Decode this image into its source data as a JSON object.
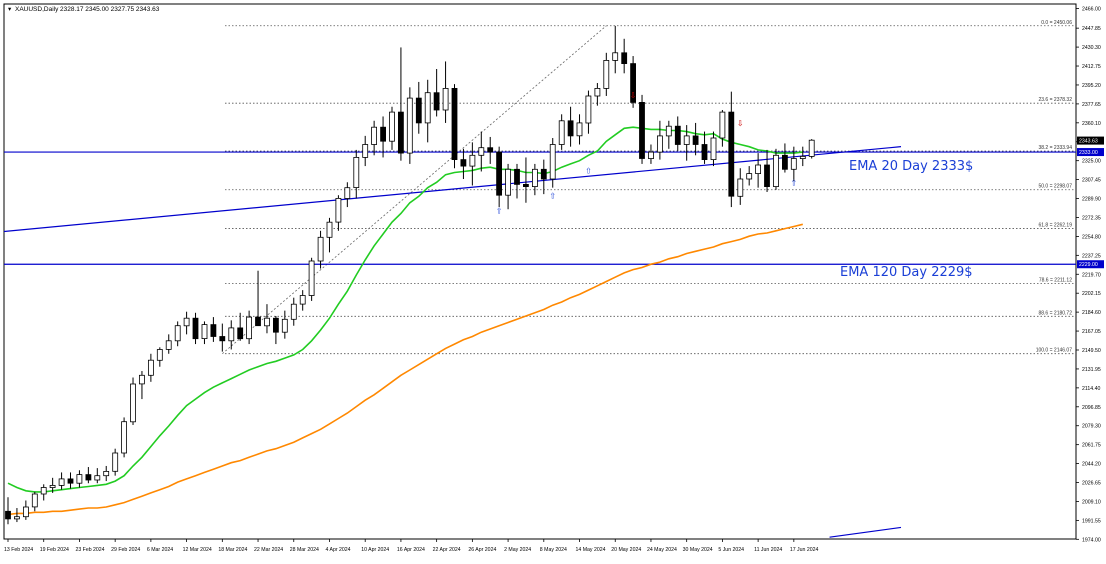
{
  "header": {
    "symbol_label": "XAUUSD,Daily",
    "ohlc_label": "2328.17 2345.00 2327.75 2343.63"
  },
  "chart_data": {
    "type": "candlestick",
    "symbol": "XAUUSD",
    "timeframe": "Daily",
    "ylim": [
      1974.0,
      2466.0
    ],
    "y_ticks": [
      1974.0,
      1991.55,
      2009.1,
      2026.65,
      2044.2,
      2061.75,
      2079.3,
      2096.85,
      2114.4,
      2131.95,
      2149.5,
      2167.05,
      2184.6,
      2202.15,
      2219.7,
      2237.25,
      2254.8,
      2272.35,
      2289.9,
      2307.45,
      2325.0,
      2342.55,
      2360.1,
      2377.65,
      2395.2,
      2412.75,
      2430.3,
      2447.85,
      2466.0
    ],
    "y_tick_labels": [
      "1974.00",
      "1991.55",
      "2009.10",
      "2026.65",
      "2044.20",
      "2061.75",
      "2079.30",
      "2096.85",
      "2114.40",
      "2131.95",
      "2149.50",
      "2167.05",
      "2184.60",
      "2202.15",
      "2219.70",
      "2237.25",
      "2254.80",
      "2272.35",
      "2289.90",
      "2307.45",
      "2325.00",
      "2342.55",
      "2360.10",
      "2377.65",
      "2395.20",
      "2412.75",
      "2430.30",
      "2447.85",
      "2466.00"
    ],
    "x_tick_labels": [
      {
        "i": 0,
        "label": "13 Feb 2024"
      },
      {
        "i": 4,
        "label": "19 Feb 2024"
      },
      {
        "i": 8,
        "label": "23 Feb 2024"
      },
      {
        "i": 12,
        "label": "29 Feb 2024"
      },
      {
        "i": 16,
        "label": "6 Mar 2024"
      },
      {
        "i": 20,
        "label": "12 Mar 2024"
      },
      {
        "i": 24,
        "label": "18 Mar 2024"
      },
      {
        "i": 28,
        "label": "22 Mar 2024"
      },
      {
        "i": 32,
        "label": "28 Mar 2024"
      },
      {
        "i": 36,
        "label": "4 Apr 2024"
      },
      {
        "i": 40,
        "label": "10 Apr 2024"
      },
      {
        "i": 44,
        "label": "16 Apr 2024"
      },
      {
        "i": 48,
        "label": "22 Apr 2024"
      },
      {
        "i": 52,
        "label": "26 Apr 2024"
      },
      {
        "i": 56,
        "label": "2 May 2024"
      },
      {
        "i": 60,
        "label": "8 May 2024"
      },
      {
        "i": 64,
        "label": "14 May 2024"
      },
      {
        "i": 68,
        "label": "20 May 2024"
      },
      {
        "i": 72,
        "label": "24 May 2024"
      },
      {
        "i": 76,
        "label": "30 May 2024"
      },
      {
        "i": 80,
        "label": "5 Jun 2024"
      },
      {
        "i": 84,
        "label": "11 Jun 2024"
      },
      {
        "i": 88,
        "label": "17 Jun 2024"
      }
    ],
    "candles": [
      {
        "o": 2000,
        "h": 2013,
        "l": 1988,
        "c": 1993
      },
      {
        "o": 1993,
        "h": 2003,
        "l": 1990,
        "c": 1995
      },
      {
        "o": 1995,
        "h": 2010,
        "l": 1992,
        "c": 2004
      },
      {
        "o": 2004,
        "h": 2018,
        "l": 2000,
        "c": 2016
      },
      {
        "o": 2016,
        "h": 2025,
        "l": 2010,
        "c": 2022
      },
      {
        "o": 2022,
        "h": 2031,
        "l": 2017,
        "c": 2024
      },
      {
        "o": 2024,
        "h": 2036,
        "l": 2020,
        "c": 2030
      },
      {
        "o": 2030,
        "h": 2036,
        "l": 2021,
        "c": 2026
      },
      {
        "o": 2026,
        "h": 2038,
        "l": 2022,
        "c": 2034
      },
      {
        "o": 2034,
        "h": 2041,
        "l": 2026,
        "c": 2029
      },
      {
        "o": 2029,
        "h": 2040,
        "l": 2026,
        "c": 2033
      },
      {
        "o": 2033,
        "h": 2042,
        "l": 2028,
        "c": 2037
      },
      {
        "o": 2037,
        "h": 2058,
        "l": 2033,
        "c": 2054
      },
      {
        "o": 2054,
        "h": 2087,
        "l": 2050,
        "c": 2083
      },
      {
        "o": 2083,
        "h": 2124,
        "l": 2080,
        "c": 2118
      },
      {
        "o": 2118,
        "h": 2130,
        "l": 2104,
        "c": 2126
      },
      {
        "o": 2126,
        "h": 2146,
        "l": 2120,
        "c": 2140
      },
      {
        "o": 2140,
        "h": 2152,
        "l": 2134,
        "c": 2150
      },
      {
        "o": 2150,
        "h": 2164,
        "l": 2146,
        "c": 2158
      },
      {
        "o": 2158,
        "h": 2176,
        "l": 2153,
        "c": 2172
      },
      {
        "o": 2172,
        "h": 2185,
        "l": 2164,
        "c": 2179
      },
      {
        "o": 2179,
        "h": 2184,
        "l": 2155,
        "c": 2160
      },
      {
        "o": 2160,
        "h": 2176,
        "l": 2155,
        "c": 2173
      },
      {
        "o": 2173,
        "h": 2180,
        "l": 2157,
        "c": 2162
      },
      {
        "o": 2162,
        "h": 2174,
        "l": 2148,
        "c": 2158
      },
      {
        "o": 2158,
        "h": 2177,
        "l": 2150,
        "c": 2170
      },
      {
        "o": 2170,
        "h": 2184,
        "l": 2158,
        "c": 2160
      },
      {
        "o": 2160,
        "h": 2186,
        "l": 2155,
        "c": 2180
      },
      {
        "o": 2180,
        "h": 2223,
        "l": 2173,
        "c": 2172
      },
      {
        "o": 2172,
        "h": 2192,
        "l": 2165,
        "c": 2179
      },
      {
        "o": 2179,
        "h": 2181,
        "l": 2155,
        "c": 2166
      },
      {
        "o": 2166,
        "h": 2186,
        "l": 2160,
        "c": 2178
      },
      {
        "o": 2178,
        "h": 2198,
        "l": 2172,
        "c": 2192
      },
      {
        "o": 2192,
        "h": 2205,
        "l": 2186,
        "c": 2200
      },
      {
        "o": 2200,
        "h": 2235,
        "l": 2195,
        "c": 2232
      },
      {
        "o": 2232,
        "h": 2260,
        "l": 2225,
        "c": 2254
      },
      {
        "o": 2254,
        "h": 2272,
        "l": 2240,
        "c": 2268
      },
      {
        "o": 2268,
        "h": 2293,
        "l": 2260,
        "c": 2290
      },
      {
        "o": 2290,
        "h": 2305,
        "l": 2282,
        "c": 2300
      },
      {
        "o": 2300,
        "h": 2335,
        "l": 2290,
        "c": 2328
      },
      {
        "o": 2328,
        "h": 2348,
        "l": 2320,
        "c": 2340
      },
      {
        "o": 2340,
        "h": 2362,
        "l": 2330,
        "c": 2356
      },
      {
        "o": 2356,
        "h": 2366,
        "l": 2328,
        "c": 2343
      },
      {
        "o": 2343,
        "h": 2375,
        "l": 2335,
        "c": 2370
      },
      {
        "o": 2370,
        "h": 2430,
        "l": 2325,
        "c": 2332
      },
      {
        "o": 2332,
        "h": 2393,
        "l": 2322,
        "c": 2383
      },
      {
        "o": 2383,
        "h": 2398,
        "l": 2350,
        "c": 2360
      },
      {
        "o": 2360,
        "h": 2400,
        "l": 2342,
        "c": 2388
      },
      {
        "o": 2388,
        "h": 2410,
        "l": 2366,
        "c": 2372
      },
      {
        "o": 2372,
        "h": 2417,
        "l": 2360,
        "c": 2392
      },
      {
        "o": 2392,
        "h": 2396,
        "l": 2318,
        "c": 2326
      },
      {
        "o": 2326,
        "h": 2336,
        "l": 2308,
        "c": 2320
      },
      {
        "o": 2320,
        "h": 2342,
        "l": 2302,
        "c": 2330
      },
      {
        "o": 2330,
        "h": 2352,
        "l": 2315,
        "c": 2337
      },
      {
        "o": 2337,
        "h": 2347,
        "l": 2322,
        "c": 2333
      },
      {
        "o": 2333,
        "h": 2338,
        "l": 2282,
        "c": 2293
      },
      {
        "o": 2293,
        "h": 2322,
        "l": 2280,
        "c": 2317
      },
      {
        "o": 2317,
        "h": 2322,
        "l": 2290,
        "c": 2303
      },
      {
        "o": 2303,
        "h": 2328,
        "l": 2286,
        "c": 2301
      },
      {
        "o": 2301,
        "h": 2322,
        "l": 2293,
        "c": 2317
      },
      {
        "o": 2317,
        "h": 2326,
        "l": 2294,
        "c": 2308
      },
      {
        "o": 2308,
        "h": 2346,
        "l": 2300,
        "c": 2340
      },
      {
        "o": 2340,
        "h": 2368,
        "l": 2335,
        "c": 2362
      },
      {
        "o": 2362,
        "h": 2375,
        "l": 2338,
        "c": 2348
      },
      {
        "o": 2348,
        "h": 2368,
        "l": 2340,
        "c": 2360
      },
      {
        "o": 2360,
        "h": 2390,
        "l": 2350,
        "c": 2385
      },
      {
        "o": 2385,
        "h": 2397,
        "l": 2376,
        "c": 2392
      },
      {
        "o": 2392,
        "h": 2425,
        "l": 2385,
        "c": 2418
      },
      {
        "o": 2418,
        "h": 2450,
        "l": 2406,
        "c": 2425
      },
      {
        "o": 2425,
        "h": 2438,
        "l": 2406,
        "c": 2415
      },
      {
        "o": 2415,
        "h": 2422,
        "l": 2374,
        "c": 2379
      },
      {
        "o": 2379,
        "h": 2386,
        "l": 2322,
        "c": 2327
      },
      {
        "o": 2327,
        "h": 2340,
        "l": 2322,
        "c": 2333
      },
      {
        "o": 2333,
        "h": 2362,
        "l": 2326,
        "c": 2348
      },
      {
        "o": 2348,
        "h": 2362,
        "l": 2336,
        "c": 2357
      },
      {
        "o": 2357,
        "h": 2366,
        "l": 2334,
        "c": 2340
      },
      {
        "o": 2340,
        "h": 2358,
        "l": 2325,
        "c": 2348
      },
      {
        "o": 2348,
        "h": 2360,
        "l": 2330,
        "c": 2340
      },
      {
        "o": 2340,
        "h": 2352,
        "l": 2322,
        "c": 2326
      },
      {
        "o": 2326,
        "h": 2352,
        "l": 2320,
        "c": 2346
      },
      {
        "o": 2346,
        "h": 2372,
        "l": 2338,
        "c": 2370
      },
      {
        "o": 2370,
        "h": 2389,
        "l": 2282,
        "c": 2292
      },
      {
        "o": 2292,
        "h": 2318,
        "l": 2284,
        "c": 2308
      },
      {
        "o": 2308,
        "h": 2320,
        "l": 2302,
        "c": 2313
      },
      {
        "o": 2313,
        "h": 2332,
        "l": 2300,
        "c": 2321
      },
      {
        "o": 2321,
        "h": 2335,
        "l": 2296,
        "c": 2301
      },
      {
        "o": 2301,
        "h": 2336,
        "l": 2298,
        "c": 2330
      },
      {
        "o": 2330,
        "h": 2341,
        "l": 2314,
        "c": 2317
      },
      {
        "o": 2317,
        "h": 2338,
        "l": 2306,
        "c": 2327
      },
      {
        "o": 2327,
        "h": 2338,
        "l": 2320,
        "c": 2329
      },
      {
        "o": 2329,
        "h": 2345,
        "l": 2327,
        "c": 2344
      }
    ],
    "series": [
      {
        "name": "EMA 20 Day",
        "color": "#22cc22",
        "values": [
          2026,
          2022,
          2019,
          2018,
          2018,
          2019,
          2020,
          2021,
          2022,
          2023,
          2024,
          2025,
          2028,
          2033,
          2042,
          2050,
          2060,
          2070,
          2079,
          2089,
          2098,
          2104,
          2110,
          2115,
          2119,
          2123,
          2127,
          2131,
          2134,
          2137,
          2139,
          2142,
          2145,
          2150,
          2158,
          2168,
          2179,
          2192,
          2204,
          2219,
          2233,
          2246,
          2257,
          2268,
          2276,
          2286,
          2292,
          2300,
          2305,
          2312,
          2314,
          2315,
          2316,
          2318,
          2319,
          2317,
          2317,
          2316,
          2314,
          2314,
          2313,
          2315,
          2319,
          2322,
          2325,
          2330,
          2334,
          2343,
          2349,
          2355,
          2356,
          2355,
          2354,
          2354,
          2353,
          2353,
          2352,
          2350,
          2349,
          2350,
          2345,
          2342,
          2340,
          2338,
          2335,
          2334,
          2332,
          2332,
          2332,
          2333
        ]
      },
      {
        "name": "EMA 120 Day",
        "color": "#ff8800",
        "values": [
          1997,
          1998,
          1998,
          1999,
          1999,
          2000,
          2000,
          2001,
          2002,
          2003,
          2003,
          2004,
          2006,
          2008,
          2011,
          2014,
          2017,
          2020,
          2023,
          2027,
          2030,
          2033,
          2036,
          2039,
          2042,
          2045,
          2047,
          2050,
          2053,
          2056,
          2058,
          2061,
          2064,
          2068,
          2072,
          2076,
          2081,
          2086,
          2091,
          2097,
          2103,
          2108,
          2114,
          2120,
          2126,
          2131,
          2136,
          2141,
          2146,
          2151,
          2155,
          2159,
          2162,
          2166,
          2169,
          2172,
          2175,
          2178,
          2181,
          2184,
          2187,
          2191,
          2194,
          2198,
          2201,
          2205,
          2209,
          2213,
          2217,
          2221,
          2224,
          2226,
          2229,
          2231,
          2234,
          2236,
          2239,
          2241,
          2243,
          2245,
          2248,
          2250,
          2252,
          2255,
          2257,
          2258,
          2260,
          2262,
          2264,
          2266
        ]
      }
    ],
    "fibonacci": [
      {
        "label": "0.0 = 2450.06",
        "value": 2450.06
      },
      {
        "label": "23.6 = 2378.32",
        "value": 2378.32
      },
      {
        "label": "38.2 = 2333.94",
        "value": 2333.94
      },
      {
        "label": "50.0 = 2298.07",
        "value": 2298.07
      },
      {
        "label": "61.8 = 2262.19",
        "value": 2262.19
      },
      {
        "label": "78.6 = 2211.12",
        "value": 2211.12
      },
      {
        "label": "88.6 = 2180.72",
        "value": 2180.72
      },
      {
        "label": "100.0 = 2146.07",
        "value": 2146.07
      }
    ],
    "horizontal_lines": [
      {
        "value": 2333.0,
        "label": "2333.00",
        "color": "#0000cc"
      },
      {
        "value": 2229.0,
        "label": "2229.00",
        "color": "#0000cc"
      }
    ],
    "current_price": {
      "value": 2343.63,
      "label": "2343.63"
    },
    "trend_lines": [
      {
        "from": {
          "i": -6,
          "v": 2255
        },
        "to": {
          "i": 100,
          "v": 2338
        },
        "color": "#0000cc"
      },
      {
        "from": {
          "i": 92,
          "v": 1976
        },
        "to": {
          "i": 100,
          "v": 1985
        },
        "color": "#0000cc"
      }
    ],
    "fib_anchor_line": {
      "from": {
        "i": 24,
        "v": 2146.07
      },
      "to": {
        "i": 67,
        "v": 2450.06
      }
    },
    "arrows_up": [
      {
        "i": 55,
        "v": 2276
      },
      {
        "i": 61,
        "v": 2290
      },
      {
        "i": 65,
        "v": 2313
      },
      {
        "i": 88,
        "v": 2302
      }
    ],
    "arrows_down": [
      {
        "i": 70,
        "v": 2383
      },
      {
        "i": 82,
        "v": 2357
      }
    ],
    "annotations": [
      {
        "text": "EMA 20 Day  2333$",
        "value": 2318,
        "color": "#1a3fd6"
      },
      {
        "text": "EMA 120 Day  2229$",
        "value": 2220,
        "color": "#1a3fd6"
      }
    ],
    "grid": false,
    "colors": {
      "bull": "#ffffff",
      "bear": "#000000",
      "outline": "#000000",
      "axis": "#000000",
      "fib": "#555555"
    }
  }
}
